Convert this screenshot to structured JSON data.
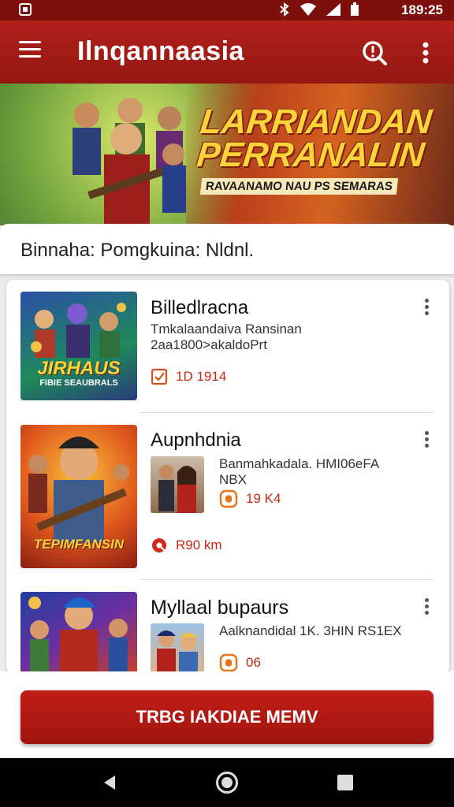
{
  "status_bar": {
    "time": "189:25"
  },
  "app_bar": {
    "title": "Ilnqannaasia"
  },
  "hero": {
    "title_line1": "LARRIANDAN",
    "title_line2": "PERRANALIN",
    "tagline": "RAVAANAMO NAU PS SEMARAS"
  },
  "filter": {
    "text": "Binnaha: Pomgkuina: Nldnl."
  },
  "items": [
    {
      "name": "Billedlracna",
      "desc_line1": "Tmkalaandaiva Ransinan",
      "desc_line2": "2aa1800>akaldoPrt",
      "thumb_caption": "JIRHAUS",
      "thumb_sub": "FIBIE SEAUBRALS",
      "meta_text": "1D 1914",
      "meta_icon": "checkbox-icon"
    },
    {
      "name": "Aupnhdnia",
      "desc_line1": "Banmahkadala. HMI06eFA",
      "desc_line2": "NBX",
      "thumb_caption": "TEPIMFANSIN",
      "rating_text": "19 K4",
      "meta_text": "R90 km",
      "meta_icon": "location-icon"
    },
    {
      "name": "Myllaal bupaurs",
      "desc_line1": "Aalknandidal 1K. 3HIN RS1EX",
      "rating_text": "06"
    }
  ],
  "primary_button": {
    "label": "TRBG IAKDIAE MEMV"
  },
  "colors": {
    "primary": "#a3150f",
    "status_bar": "#7d0f0c",
    "accent_orange": "#e8731d"
  }
}
